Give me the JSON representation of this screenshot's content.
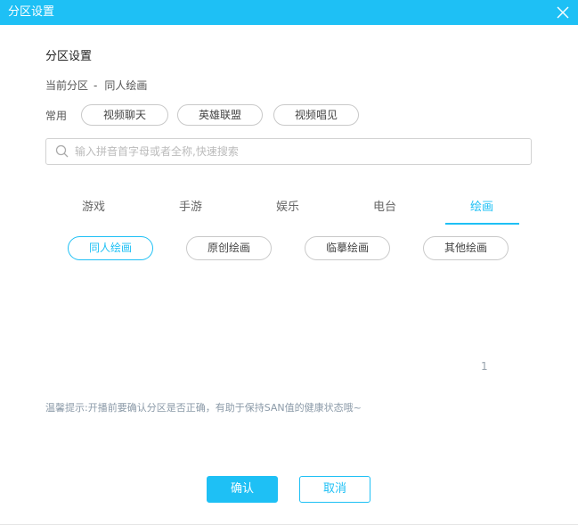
{
  "window": {
    "title": "分区设置"
  },
  "section": {
    "title": "分区设置",
    "current_label": "当前分区",
    "current_sep": "-",
    "current_value": "同人绘画"
  },
  "common": {
    "label": "常用",
    "items": [
      "视频聊天",
      "英雄联盟",
      "视频唱见"
    ]
  },
  "search": {
    "placeholder": "输入拼音首字母或者全称,快速搜索",
    "value": ""
  },
  "tabs": [
    {
      "label": "游戏",
      "active": false
    },
    {
      "label": "手游",
      "active": false
    },
    {
      "label": "娱乐",
      "active": false
    },
    {
      "label": "电台",
      "active": false
    },
    {
      "label": "绘画",
      "active": true
    }
  ],
  "subcategories": [
    {
      "label": "同人绘画",
      "active": true
    },
    {
      "label": "原创绘画",
      "active": false
    },
    {
      "label": "临摹绘画",
      "active": false
    },
    {
      "label": "其他绘画",
      "active": false
    }
  ],
  "pagination": {
    "current_page": "1"
  },
  "tip": "温馨提示:开播前要确认分区是否正确，有助于保持SAN值的健康状态哦~",
  "buttons": {
    "confirm": "确认",
    "cancel": "取消"
  },
  "colors": {
    "accent": "#1ec0f5",
    "tip_text": "#8b9aa8"
  },
  "icons": {
    "close": "close-icon",
    "search": "search-icon"
  }
}
